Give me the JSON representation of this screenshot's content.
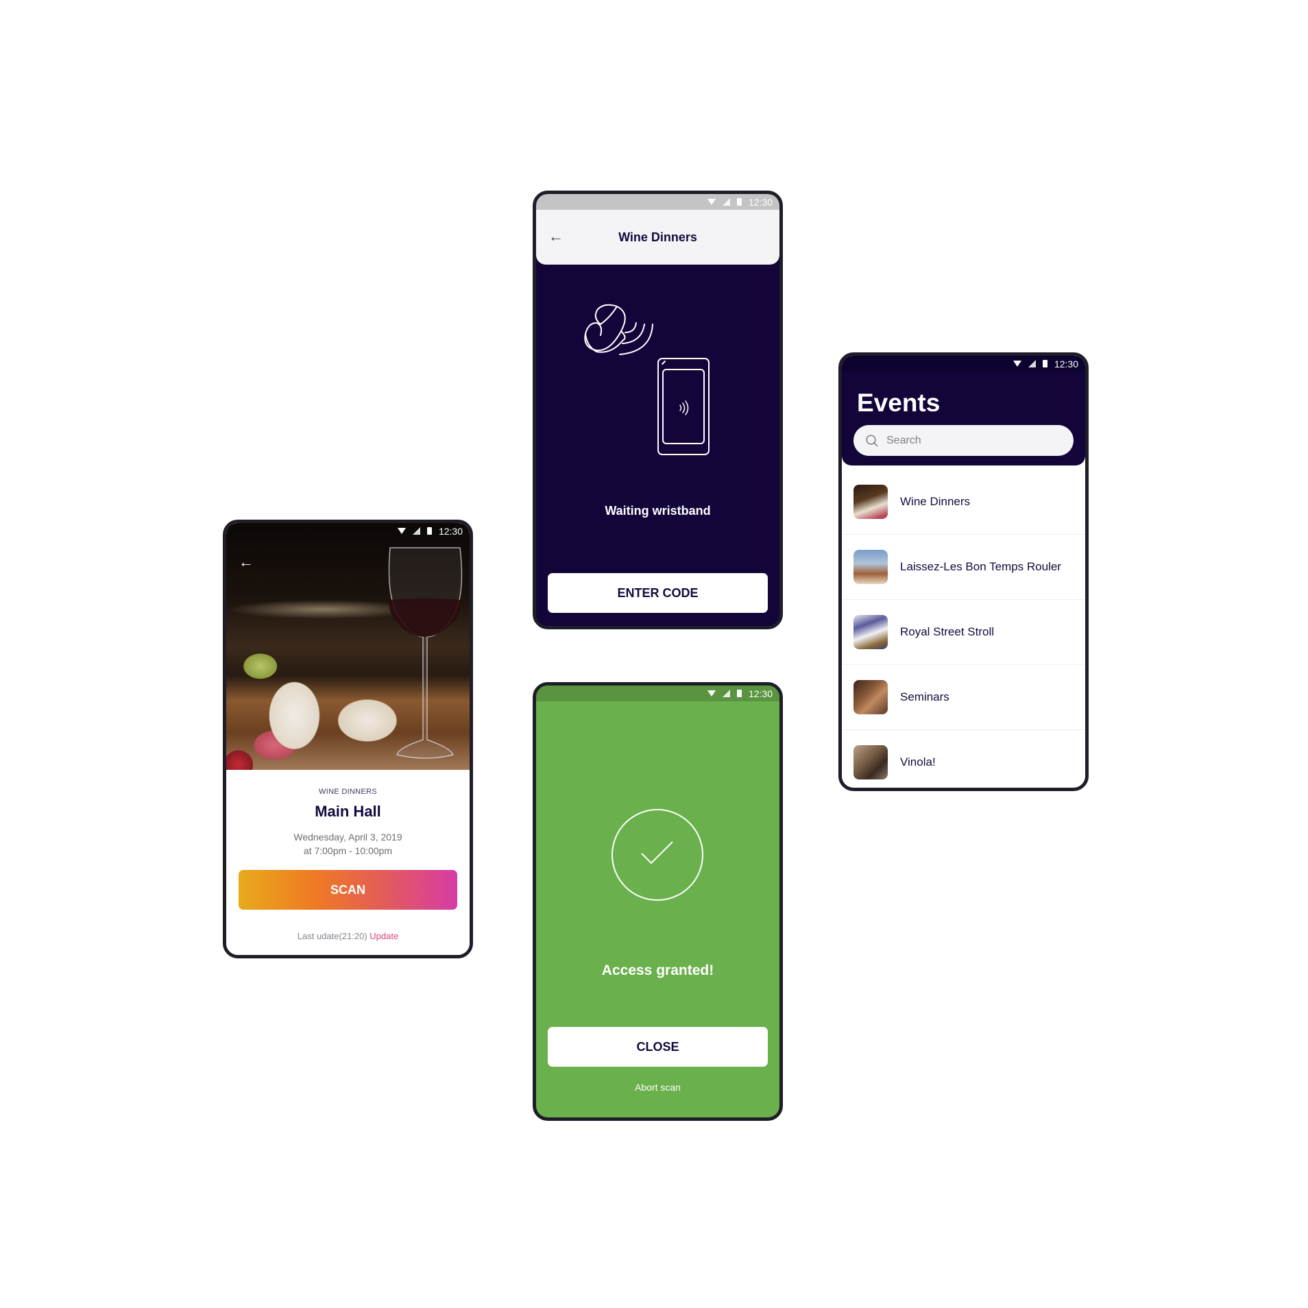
{
  "status_bar": {
    "time": "12:30"
  },
  "detail_screen": {
    "eyebrow": "WINE DINNERS",
    "title": "Main Hall",
    "date_line": "Wednesday, April 3, 2019",
    "time_line": "at 7:00pm - 10:00pm",
    "scan_label": "SCAN",
    "last_update_text": "Last udate(21:20)",
    "update_link": "Update",
    "hero_image": "wine-and-cheese-photo"
  },
  "waiting_screen": {
    "title": "Wine Dinners",
    "message": "Waiting wristband",
    "enter_code_label": "ENTER CODE",
    "illustration": "wristband-to-phone-nfc-icon"
  },
  "granted_screen": {
    "message": "Access granted!",
    "close_label": "CLOSE",
    "abort_label": "Abort scan",
    "accent": "#6ab04c"
  },
  "events_screen": {
    "title": "Events",
    "search_placeholder": "Search",
    "items": [
      {
        "name": "Wine Dinners"
      },
      {
        "name": "Laissez-Les Bon Temps Rouler"
      },
      {
        "name": "Royal Street Stroll"
      },
      {
        "name": "Seminars"
      },
      {
        "name": "Vinola!"
      }
    ]
  },
  "colors": {
    "primary_dark": "#13053a",
    "success_green": "#6ab04c",
    "gradient_start": "#e8a91c",
    "gradient_end": "#d63ca6",
    "link_pink": "#e0407c"
  }
}
